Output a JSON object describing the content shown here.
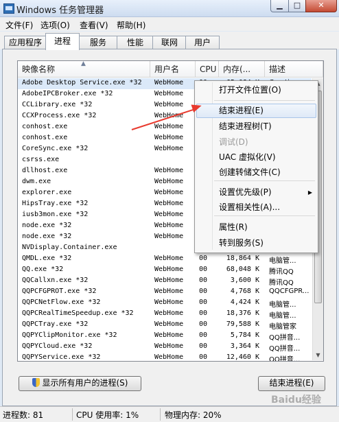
{
  "window": {
    "title": "Windows 任务管理器",
    "min": "▁",
    "max": "□",
    "close": "✕"
  },
  "menu": [
    "文件(F)",
    "选项(O)",
    "查看(V)",
    "帮助(H)"
  ],
  "tabs": [
    "应用程序",
    "进程",
    "服务",
    "性能",
    "联网",
    "用户"
  ],
  "active_tab": "进程",
  "columns": {
    "name": "映像名称",
    "user": "用户名",
    "cpu": "CPU",
    "mem": "内存(...",
    "desc": "描述"
  },
  "processes": [
    {
      "name": "Adobe Desktop Service.exe *32",
      "user": "WebHome",
      "cpu": "00",
      "mem": "65,084 K",
      "desc": "Creative ..."
    },
    {
      "name": "AdobeIPCBroker.exe *32",
      "user": "WebHome",
      "cpu": "",
      "mem": "",
      "desc": ""
    },
    {
      "name": "CCLibrary.exe *32",
      "user": "WebHome",
      "cpu": "",
      "mem": "",
      "desc": ""
    },
    {
      "name": "CCXProcess.exe *32",
      "user": "WebHome",
      "cpu": "",
      "mem": "",
      "desc": ""
    },
    {
      "name": "conhost.exe",
      "user": "WebHome",
      "cpu": "",
      "mem": "",
      "desc": ""
    },
    {
      "name": "conhost.exe",
      "user": "WebHome",
      "cpu": "",
      "mem": "",
      "desc": ""
    },
    {
      "name": "CoreSync.exe *32",
      "user": "WebHome",
      "cpu": "",
      "mem": "",
      "desc": ""
    },
    {
      "name": "csrss.exe",
      "user": "",
      "cpu": "",
      "mem": "",
      "desc": ""
    },
    {
      "name": "dllhost.exe",
      "user": "WebHome",
      "cpu": "",
      "mem": "",
      "desc": ""
    },
    {
      "name": "dwm.exe",
      "user": "WebHome",
      "cpu": "",
      "mem": "",
      "desc": ""
    },
    {
      "name": "explorer.exe",
      "user": "WebHome",
      "cpu": "",
      "mem": "",
      "desc": ""
    },
    {
      "name": "HipsTray.exe *32",
      "user": "WebHome",
      "cpu": "",
      "mem": "",
      "desc": ""
    },
    {
      "name": "iusb3mon.exe *32",
      "user": "WebHome",
      "cpu": "",
      "mem": "",
      "desc": ""
    },
    {
      "name": "node.exe *32",
      "user": "WebHome",
      "cpu": "",
      "mem": "",
      "desc": ""
    },
    {
      "name": "node.exe *32",
      "user": "WebHome",
      "cpu": "",
      "mem": "",
      "desc": ""
    },
    {
      "name": "NVDisplay.Container.exe",
      "user": "",
      "cpu": "",
      "mem": "",
      "desc": ""
    },
    {
      "name": "QMDL.exe *32",
      "user": "WebHome",
      "cpu": "00",
      "mem": "18,864 K",
      "desc": "电脑管..."
    },
    {
      "name": "QQ.exe *32",
      "user": "WebHome",
      "cpu": "00",
      "mem": "68,048 K",
      "desc": "腾讯QQ"
    },
    {
      "name": "QQCallxn.exe *32",
      "user": "WebHome",
      "cpu": "00",
      "mem": "3,600 K",
      "desc": "腾讯QQ"
    },
    {
      "name": "QQPCFGPROT.exe *32",
      "user": "WebHome",
      "cpu": "00",
      "mem": "4,768 K",
      "desc": "QQCFGPR..."
    },
    {
      "name": "QQPCNetFlow.exe *32",
      "user": "WebHome",
      "cpu": "00",
      "mem": "4,424 K",
      "desc": "电脑管..."
    },
    {
      "name": "QQPCRealTimeSpeedup.exe *32",
      "user": "WebHome",
      "cpu": "00",
      "mem": "18,376 K",
      "desc": "电脑管..."
    },
    {
      "name": "QQPCTray.exe *32",
      "user": "WebHome",
      "cpu": "00",
      "mem": "79,588 K",
      "desc": "电脑管家"
    },
    {
      "name": "QQPYClipMonitor.exe *32",
      "user": "WebHome",
      "cpu": "00",
      "mem": "5,784 K",
      "desc": "QQ拼音..."
    },
    {
      "name": "QQPYCloud.exe *32",
      "user": "WebHome",
      "cpu": "00",
      "mem": "3,364 K",
      "desc": "QQ拼音..."
    },
    {
      "name": "QQPYService.exe *32",
      "user": "WebHome",
      "cpu": "00",
      "mem": "12,460 K",
      "desc": "QQ拼音..."
    }
  ],
  "buttons": {
    "show_all": "显示所有用户的进程(S)",
    "end_process": "结束进程(E)"
  },
  "status": {
    "procs": "进程数: 81",
    "cpu": "CPU 使用率: 1%",
    "mem": "物理内存: 20%"
  },
  "context_menu": [
    {
      "label": "打开文件位置(O)",
      "state": "normal"
    },
    {
      "label": "结束进程(E)",
      "state": "highlighted"
    },
    {
      "label": "结束进程树(T)",
      "state": "normal"
    },
    {
      "label": "调试(D)",
      "state": "disabled"
    },
    {
      "label": "UAC 虚拟化(V)",
      "state": "normal"
    },
    {
      "label": "创建转储文件(C)",
      "state": "normal"
    },
    {
      "label": "设置优先级(P)",
      "state": "submenu"
    },
    {
      "label": "设置相关性(A)...",
      "state": "normal"
    },
    {
      "label": "属性(R)",
      "state": "normal"
    },
    {
      "label": "转到服务(S)",
      "state": "normal"
    }
  ],
  "watermark": "Baidu经验",
  "colors": {
    "selection": "#dbe9f9",
    "annotation_arrow": "#e83a2e",
    "close_button": "#c44a33"
  }
}
